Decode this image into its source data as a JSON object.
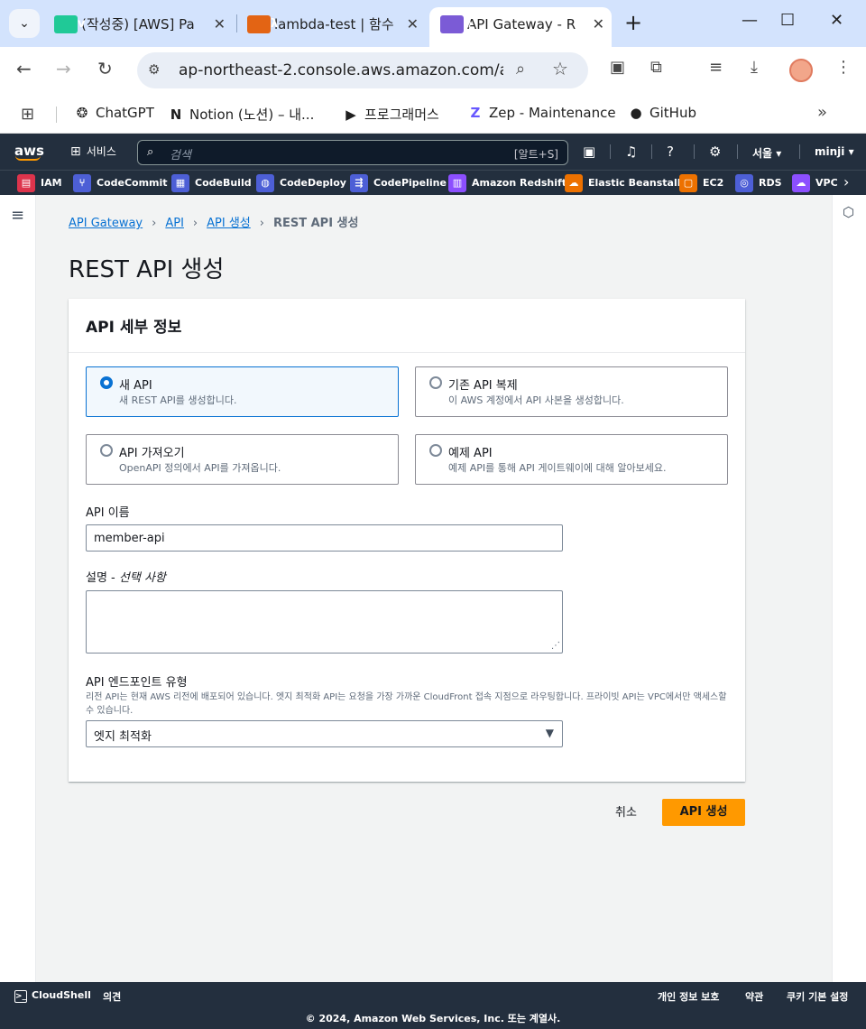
{
  "browser": {
    "tabs": [
      {
        "title": "(작성중) [AWS] Pa",
        "favicon": "v",
        "favicon_color": "#20c997"
      },
      {
        "title": "lambda-test | 함수",
        "favicon": "λ",
        "favicon_color": "#e36414"
      },
      {
        "title": "API Gateway - RES",
        "favicon": "⟨⟩",
        "favicon_color": "#7b5bd6"
      }
    ],
    "url": "ap-northeast-2.console.aws.amazon.com/a...",
    "bookmarks": [
      {
        "label": "ChatGPT",
        "icon": "❂"
      },
      {
        "label": "Notion (노션) – 내...",
        "icon": "N"
      },
      {
        "label": "프로그래머스",
        "icon": "▶"
      },
      {
        "label": "Zep - Maintenance",
        "icon": "Z"
      },
      {
        "label": "GitHub",
        "icon": "●"
      }
    ]
  },
  "aws_nav": {
    "logo": "aws",
    "services": "서비스",
    "search_placeholder": "검색",
    "search_shortcut": "[알트+S]",
    "region": "서울 ▾",
    "user": "minji ▾"
  },
  "favorites": [
    {
      "label": "IAM",
      "color": "#dd344c"
    },
    {
      "label": "CodeCommit",
      "color": "#4d5fd6"
    },
    {
      "label": "CodeBuild",
      "color": "#4d5fd6"
    },
    {
      "label": "CodeDeploy",
      "color": "#4d5fd6"
    },
    {
      "label": "CodePipeline",
      "color": "#4d5fd6"
    },
    {
      "label": "Amazon Redshift",
      "color": "#8c4fff"
    },
    {
      "label": "Elastic Beanstalk",
      "color": "#ed7100"
    },
    {
      "label": "EC2",
      "color": "#ed7100"
    },
    {
      "label": "RDS",
      "color": "#4d5fd6"
    },
    {
      "label": "VPC",
      "color": "#8c4fff"
    }
  ],
  "breadcrumb": {
    "items": [
      "API Gateway",
      "API",
      "API 생성"
    ],
    "current": "REST API 생성"
  },
  "page_title": "REST API 생성",
  "panel": {
    "title": "API 세부 정보",
    "options": [
      {
        "label": "새 API",
        "desc": "새 REST API를 생성합니다.",
        "selected": true
      },
      {
        "label": "기존 API 복제",
        "desc": "이 AWS 계정에서 API 사본을 생성합니다.",
        "selected": false
      },
      {
        "label": "API 가져오기",
        "desc": "OpenAPI 정의에서 API를 가져옵니다.",
        "selected": false
      },
      {
        "label": "예제 API",
        "desc": "예제 API를 통해 API 게이트웨이에 대해 알아보세요.",
        "selected": false
      }
    ],
    "name_label": "API 이름",
    "name_value": "member-api",
    "desc_label": "설명",
    "desc_optional": "선택 사항",
    "endpoint_label": "API 엔드포인트 유형",
    "endpoint_help": "리전 API는 현재 AWS 리전에 배포되어 있습니다. 엣지 최적화 API는 요청을 가장 가까운 CloudFront 접속 지점으로 라우팅합니다. 프라이빗 API는 VPC에서만 액세스할 수 있습니다.",
    "endpoint_value": "엣지 최적화"
  },
  "actions": {
    "cancel": "취소",
    "create": "API 생성"
  },
  "footer": {
    "cloudshell": "CloudShell",
    "feedback": "의견",
    "privacy": "개인 정보 보호",
    "terms": "약관",
    "cookies": "쿠키 기본 설정",
    "copyright": "© 2024, Amazon Web Services, Inc. 또는 계열사."
  }
}
